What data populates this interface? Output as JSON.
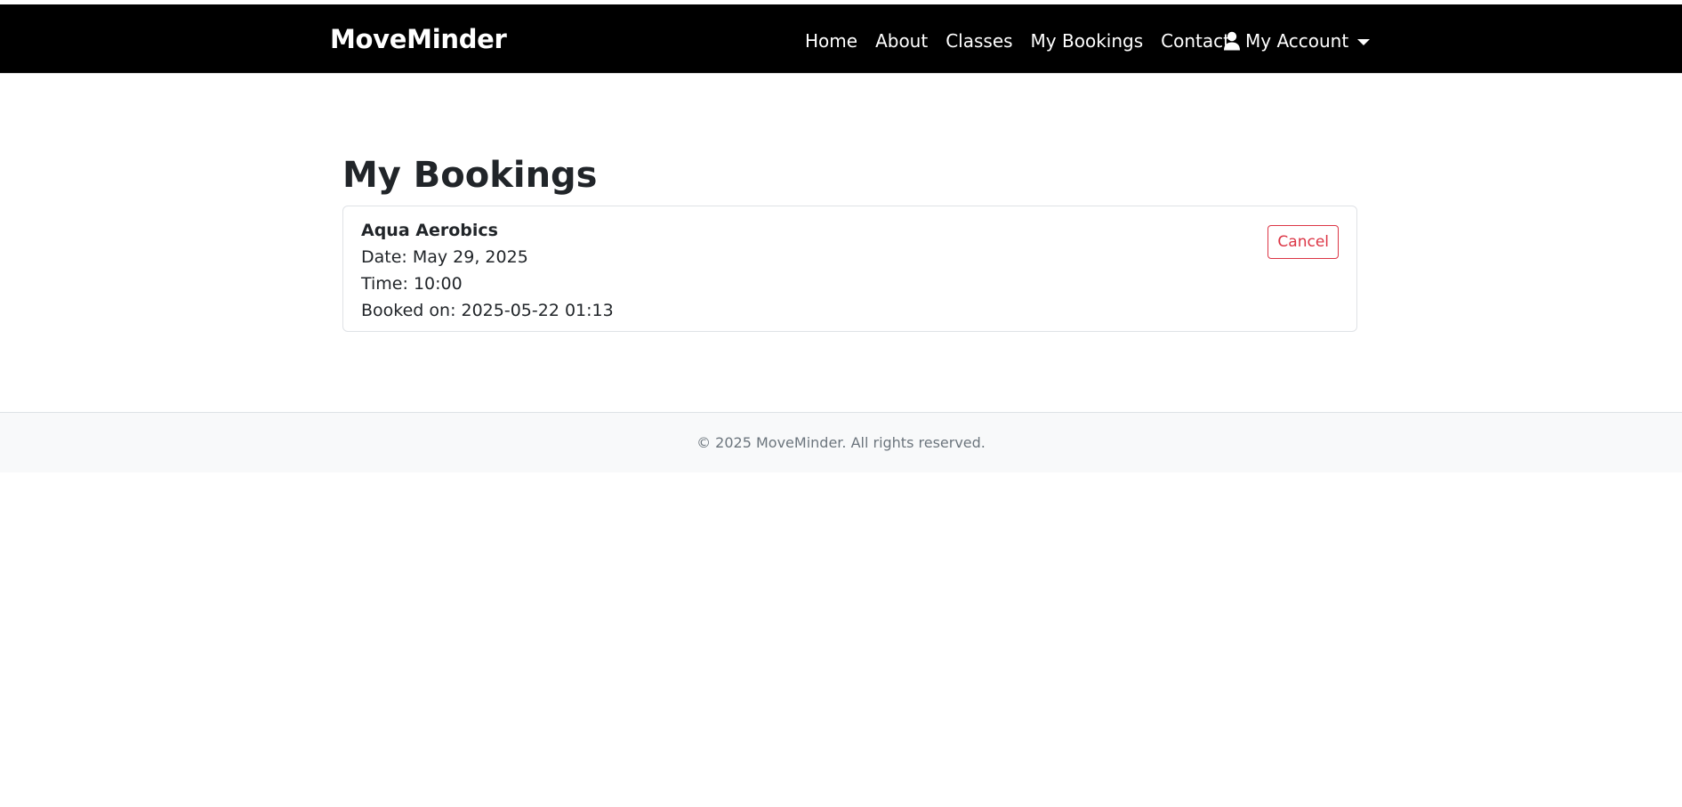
{
  "navbar": {
    "brand": "MoveMinder",
    "links": [
      {
        "label": "Home"
      },
      {
        "label": "About"
      },
      {
        "label": "Classes"
      },
      {
        "label": "My Bookings"
      },
      {
        "label": "Contact"
      }
    ],
    "account": {
      "icon": "user-icon",
      "label": "My Account",
      "dropdown_icon": "caret-down-icon"
    },
    "background_color": "#000000"
  },
  "main": {
    "title": "My Bookings",
    "bookings": [
      {
        "class_name": "Aqua Aerobics",
        "date": "Date: May 29, 2025",
        "time": "Time: 10:00",
        "booked_on": "Booked on: 2025-05-22 01:13",
        "cancel_label": "Cancel"
      }
    ]
  },
  "footer": {
    "text": "© 2025 MoveMinder. All rights reserved."
  },
  "colors": {
    "danger": "#dc3545",
    "footer_bg": "#f8f9fa",
    "muted_text": "#6c757d"
  }
}
